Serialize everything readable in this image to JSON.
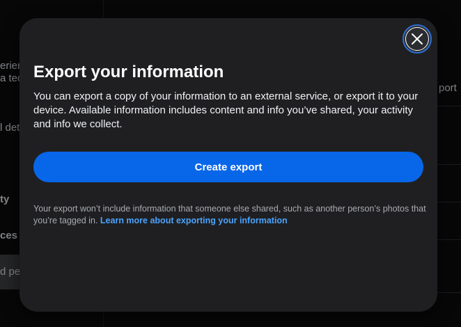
{
  "background": {
    "fragments": [
      "erien",
      "a tec",
      "l det",
      "ty",
      "ces",
      "d per",
      "port"
    ]
  },
  "dialog": {
    "title": "Export your information",
    "description": "You can export a copy of your information to an external service, or export it to your device. Available information includes content and info you’ve shared, your activity and info we collect.",
    "primary_button": "Create export",
    "note_text": "Your export won’t include information that someone else shared, such as another person’s photos that you’re tagged in.",
    "note_link": "Learn more about exporting your information"
  },
  "icons": {
    "close": "close-icon"
  },
  "colors": {
    "modal_bg": "#1f1f21",
    "primary": "#0866e8",
    "link": "#4aa3ff",
    "focus_ring": "#2d6fd6"
  }
}
